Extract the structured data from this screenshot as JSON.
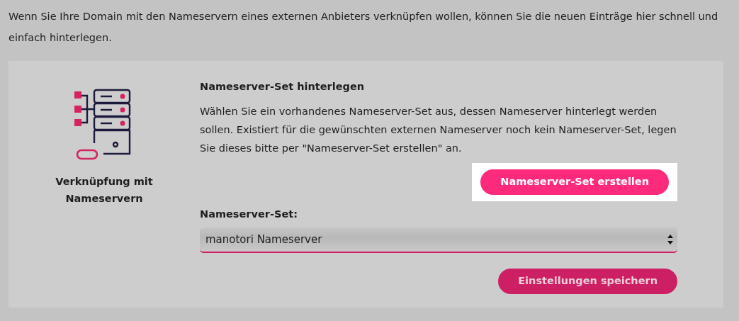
{
  "intro": "Wenn Sie Ihre Domain mit den Nameservern eines externen Anbieters verknüpfen wollen, können Sie die neuen Einträge hier schnell und einfach hinterlegen.",
  "panel": {
    "caption": "Verknüpfung mit Nameservern",
    "heading": "Nameserver-Set hinterlegen",
    "description": "Wählen Sie ein vorhandenes Nameserver-Set aus, dessen Nameserver hinterlegt werden sollen. Existiert für die gewünschten externen Nameserver noch kein Nameserver-Set, legen Sie dieses bitte per \"Nameserver-Set erstellen\" an.",
    "create_button": {
      "label": "Nameserver-Set erstellen",
      "highlighted": true
    },
    "select_label": "Nameserver-Set:",
    "select_value": "manotori Nameserver",
    "save_button": {
      "label": "Einstellungen speichern",
      "highlighted": false
    }
  }
}
